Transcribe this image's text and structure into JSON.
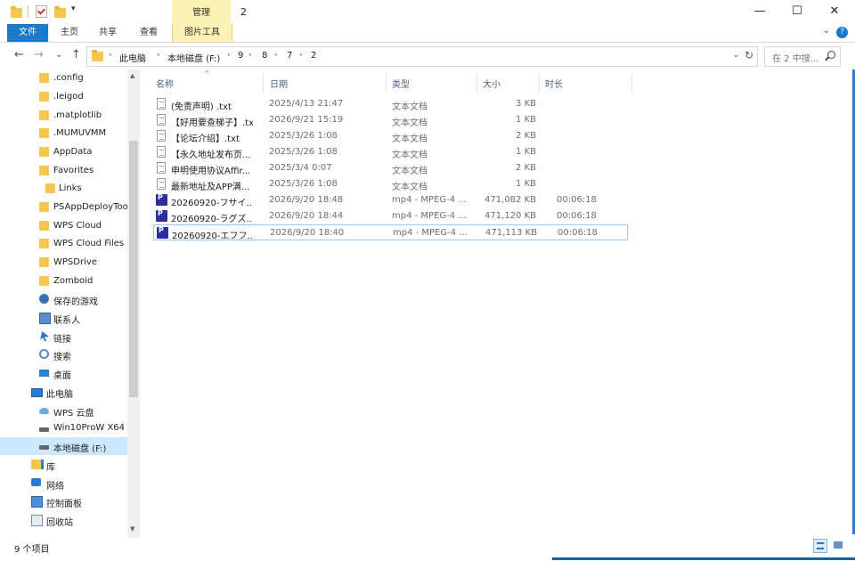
{
  "titlebar": {
    "title": "2",
    "context_group": "管理",
    "qa_dropdown": "▾"
  },
  "window_controls": {
    "minimize": "—",
    "maximize": "☐",
    "close": "✕"
  },
  "ribbon": {
    "tabs": [
      "文件",
      "主页",
      "共享",
      "查看",
      "图片工具"
    ],
    "collapse": "⌄",
    "help": "?"
  },
  "nav_buttons": {
    "back": "←",
    "forward": "→",
    "recent": "⌄",
    "up": "↑"
  },
  "address": {
    "crumbs": [
      "此电脑",
      "本地磁盘 (F:)",
      "9",
      "8",
      "7",
      "2"
    ],
    "sep": "›",
    "dropdown": "⌄",
    "refresh": "↻"
  },
  "search": {
    "placeholder": "在 2 中搜...",
    "icon": "search-icon"
  },
  "nav_pane": {
    "items": [
      {
        "label": ".config",
        "icon": "folder-icon"
      },
      {
        "label": ".leigod",
        "icon": "folder-icon"
      },
      {
        "label": ".matplotlib",
        "icon": "folder-icon"
      },
      {
        "label": ".MUMUVMM",
        "icon": "folder-icon"
      },
      {
        "label": "AppData",
        "icon": "folder-icon"
      },
      {
        "label": "Favorites",
        "icon": "folder-icon"
      },
      {
        "label": "Links",
        "icon": "folder-icon"
      },
      {
        "label": "PSAppDeployToo",
        "icon": "folder-icon"
      },
      {
        "label": "WPS Cloud",
        "icon": "folder-icon"
      },
      {
        "label": "WPS Cloud Files",
        "icon": "folder-icon"
      },
      {
        "label": "WPSDrive",
        "icon": "folder-icon"
      },
      {
        "label": "Zomboid",
        "icon": "folder-icon"
      },
      {
        "label": "保存的游戏",
        "icon": "saved-games-icon"
      },
      {
        "label": "联系人",
        "icon": "contacts-icon"
      },
      {
        "label": "链接",
        "icon": "links-icon"
      },
      {
        "label": "搜索",
        "icon": "searches-icon"
      },
      {
        "label": "桌面",
        "icon": "desktop-icon"
      },
      {
        "label": "此电脑",
        "icon": "this-pc-icon"
      },
      {
        "label": "WPS 云盘",
        "icon": "cloud-icon"
      },
      {
        "label": "Win10ProW X64",
        "icon": "drive-icon"
      },
      {
        "label": "本地磁盘 (F:)",
        "icon": "drive-icon"
      },
      {
        "label": "库",
        "icon": "library-icon"
      },
      {
        "label": "网络",
        "icon": "network-icon"
      },
      {
        "label": "控制面板",
        "icon": "control-panel-icon"
      },
      {
        "label": "回收站",
        "icon": "recycle-bin-icon"
      }
    ],
    "selected_index": 20
  },
  "scroll_arrows": {
    "up": "▲",
    "down": "▼"
  },
  "columns": {
    "name": "名称",
    "date": "日期",
    "type": "类型",
    "size": "大小",
    "length": "时长",
    "sort_indicator": "^"
  },
  "files": [
    {
      "name": "(免责声明) .txt",
      "date": "2025/4/13 21:47",
      "type": "文本文档",
      "size": "3 KB",
      "length": "",
      "icon": "txt-file-icon"
    },
    {
      "name": "【好用要查梯子】.txt",
      "date": "2026/9/21 15:19",
      "type": "文本文档",
      "size": "1 KB",
      "length": "",
      "icon": "txt-file-icon"
    },
    {
      "name": "【论坛介绍】.txt",
      "date": "2025/3/26 1:08",
      "type": "文本文档",
      "size": "2 KB",
      "length": "",
      "icon": "txt-file-icon"
    },
    {
      "name": "【永久地址发布页...",
      "date": "2025/3/26 1:08",
      "type": "文本文档",
      "size": "1 KB",
      "length": "",
      "icon": "txt-file-icon"
    },
    {
      "name": "申明使用协议Affir...",
      "date": "2025/3/4 0:07",
      "type": "文本文档",
      "size": "2 KB",
      "length": "",
      "icon": "txt-file-icon"
    },
    {
      "name": "最新地址及APP满...",
      "date": "2025/3/26 1:08",
      "type": "文本文档",
      "size": "1 KB",
      "length": "",
      "icon": "txt-file-icon"
    },
    {
      "name": "20260920-フサイ...",
      "date": "2026/9/20 18:48",
      "type": "mp4 - MPEG-4 ...",
      "size": "471,082 KB",
      "length": "00:06:18",
      "icon": "mp4-file-icon"
    },
    {
      "name": "20260920-ラグズ...",
      "date": "2026/9/20 18:44",
      "type": "mp4 - MPEG-4 ...",
      "size": "471,120 KB",
      "length": "00:06:18",
      "icon": "mp4-file-icon"
    },
    {
      "name": "20260920-エフフ...",
      "date": "2026/9/20 18:40",
      "type": "mp4 - MPEG-4 ...",
      "size": "471,113 KB",
      "length": "00:06:18",
      "icon": "mp4-file-icon"
    }
  ],
  "focused_row": 8,
  "status": {
    "count": "9 个项目"
  },
  "colors": {
    "accent": "#1979ca",
    "context_tab": "#fdf2b5",
    "selected_bg": "#cce8ff",
    "folder": "#f6c74e"
  }
}
